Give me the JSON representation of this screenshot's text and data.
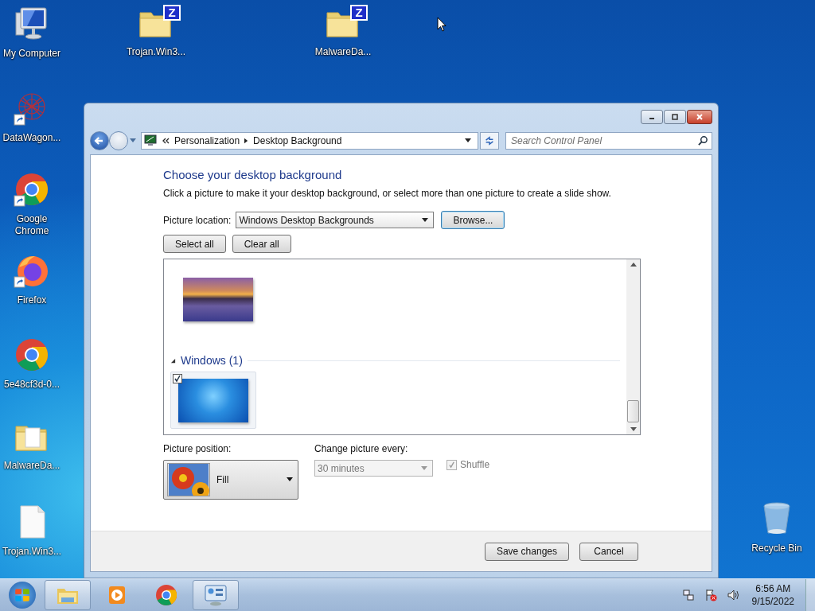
{
  "desktop": {
    "icons": [
      {
        "label": "My Computer",
        "kind": "computer",
        "shortcut": false
      },
      {
        "label": "Trojan.Win3...",
        "kind": "zip",
        "badge": "Z",
        "shortcut": false
      },
      {
        "label": "MalwareDa...",
        "kind": "zip",
        "badge": "Z",
        "shortcut": false
      },
      {
        "label": "DataWagon...",
        "kind": "network",
        "shortcut": true
      },
      {
        "label": "Google Chrome",
        "kind": "chrome",
        "shortcut": true
      },
      {
        "label": "Firefox",
        "kind": "firefox",
        "shortcut": true
      },
      {
        "label": "5e48cf3d-0...",
        "kind": "chrome",
        "shortcut": false
      },
      {
        "label": "MalwareDa...",
        "kind": "folder",
        "shortcut": false
      },
      {
        "label": "Trojan.Win3...",
        "kind": "file",
        "shortcut": false
      },
      {
        "label": "Recycle Bin",
        "kind": "recycle",
        "shortcut": false
      }
    ]
  },
  "window": {
    "address": {
      "breadcrumb": [
        "Personalization",
        "Desktop Background"
      ],
      "search_placeholder": "Search Control Panel"
    },
    "heading": "Choose your desktop background",
    "description": "Click a picture to make it your desktop background, or select more than one picture to create a slide show.",
    "picture_location": {
      "label": "Picture location:",
      "value": "Windows Desktop Backgrounds"
    },
    "browse_button": "Browse...",
    "select_all_button": "Select all",
    "clear_all_button": "Clear all",
    "pictures": {
      "items": [
        {
          "kind": "lake",
          "checked": false
        }
      ],
      "groups": [
        {
          "title": "Windows (1)",
          "expanded": true,
          "items": [
            {
              "kind": "windows",
              "checked": true
            }
          ]
        }
      ]
    },
    "picture_position": {
      "label": "Picture position:",
      "value": "Fill"
    },
    "change_picture": {
      "label": "Change picture every:",
      "value": "30 minutes",
      "disabled": true
    },
    "shuffle": {
      "label": "Shuffle",
      "checked": true,
      "disabled": true
    },
    "buttons": [
      "Save changes",
      "Cancel"
    ]
  },
  "taskbar": {
    "items": [
      {
        "kind": "explorer",
        "open": true
      },
      {
        "kind": "media",
        "open": false
      },
      {
        "kind": "chrome",
        "open": false
      },
      {
        "kind": "control-panel",
        "open": true
      }
    ],
    "clock": {
      "time": "6:56 AM",
      "date": "9/15/2022"
    }
  }
}
